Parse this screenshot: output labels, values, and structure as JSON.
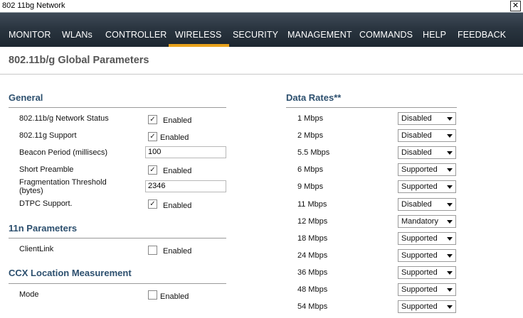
{
  "window": {
    "title": "802 11bg Network"
  },
  "nav": {
    "tabs": [
      "MONITOR",
      "WLANs",
      "CONTROLLER",
      "WIRELESS",
      "SECURITY",
      "MANAGEMENT",
      "COMMANDS",
      "HELP",
      "FEEDBACK"
    ],
    "active": "WIRELESS"
  },
  "page": {
    "title": "802.11b/g Global Parameters"
  },
  "general": {
    "title": "General",
    "network_status": {
      "label": "802.11b/g Network Status",
      "checked": true,
      "text": "Enabled"
    },
    "g_support": {
      "label": "802.11g Support",
      "checked": true,
      "text": "Enabled"
    },
    "beacon_period": {
      "label": "Beacon Period (millisecs)",
      "value": "100"
    },
    "short_preamble": {
      "label": "Short Preamble",
      "checked": true,
      "text": "Enabled"
    },
    "frag_threshold": {
      "label_line1": "Fragmentation Threshold",
      "label_line2": "(bytes)",
      "value": "2346"
    },
    "dtpc": {
      "label": "DTPC Support.",
      "checked": true,
      "text": "Enabled"
    }
  },
  "n11": {
    "title": "11n Parameters",
    "clientlink": {
      "label": "ClientLink",
      "checked": false,
      "text": "Enabled"
    }
  },
  "ccx": {
    "title": "CCX Location Measurement",
    "mode": {
      "label": "Mode",
      "checked": false,
      "text": "Enabled"
    }
  },
  "data_rates": {
    "title": "Data Rates**",
    "rows": [
      {
        "rate": "1 Mbps",
        "value": "Disabled"
      },
      {
        "rate": "2 Mbps",
        "value": "Disabled"
      },
      {
        "rate": "5.5 Mbps",
        "value": "Disabled"
      },
      {
        "rate": "6 Mbps",
        "value": "Supported"
      },
      {
        "rate": "9 Mbps",
        "value": "Supported"
      },
      {
        "rate": "11 Mbps",
        "value": "Disabled"
      },
      {
        "rate": "12 Mbps",
        "value": "Mandatory"
      },
      {
        "rate": "18 Mbps",
        "value": "Supported"
      },
      {
        "rate": "24 Mbps",
        "value": "Supported"
      },
      {
        "rate": "36 Mbps",
        "value": "Supported"
      },
      {
        "rate": "48 Mbps",
        "value": "Supported"
      },
      {
        "rate": "54 Mbps",
        "value": "Supported"
      }
    ]
  },
  "colors": {
    "nav_bg": "#2a3540",
    "active_underline": "#e8a21b",
    "section_title": "#2c4f6e"
  }
}
